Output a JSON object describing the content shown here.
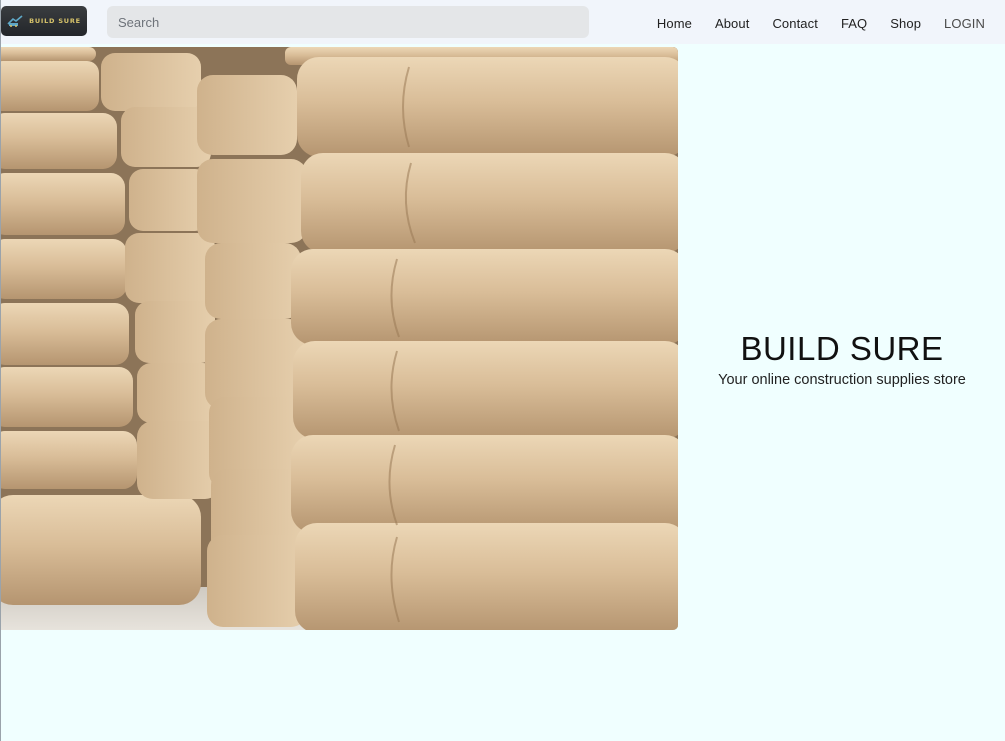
{
  "brand": {
    "logo_text": "BUILD SURE",
    "logo_icon": "truck-logo-icon"
  },
  "search": {
    "placeholder": "Search",
    "value": ""
  },
  "nav": {
    "items": [
      {
        "label": "Home"
      },
      {
        "label": "About"
      },
      {
        "label": "Contact"
      },
      {
        "label": "FAQ"
      },
      {
        "label": "Shop"
      },
      {
        "label": "LOGIN"
      }
    ]
  },
  "hero": {
    "title": "BUILD SURE",
    "subtitle": "Your online construction supplies store"
  },
  "colors": {
    "page_background": "#f0ffff",
    "navbar_background": "#f1f5fb",
    "search_background": "#e4e6e8",
    "logo_background": "#2b2e31",
    "logo_text": "#d8c46a",
    "bag_color": "#d9bd98"
  }
}
